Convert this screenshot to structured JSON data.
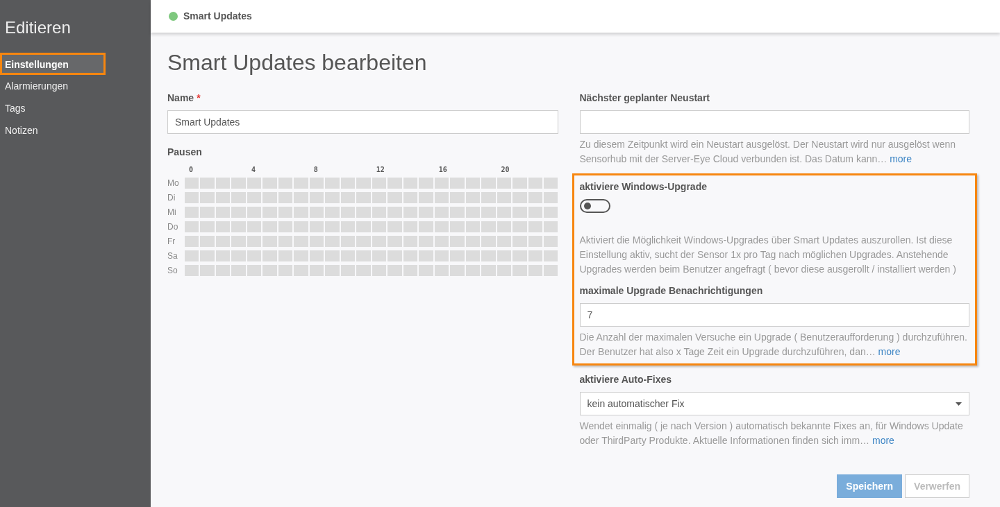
{
  "sidebar": {
    "title": "Editieren",
    "items": [
      {
        "label": "Einstellungen",
        "selected": true,
        "highlighted": true
      },
      {
        "label": "Alarmierungen",
        "selected": false,
        "highlighted": false
      },
      {
        "label": "Tags",
        "selected": false,
        "highlighted": false
      },
      {
        "label": "Notizen",
        "selected": false,
        "highlighted": false
      }
    ]
  },
  "header": {
    "title": "Smart Updates"
  },
  "page_title": "Smart Updates bearbeiten",
  "name_field": {
    "label": "Name",
    "required_mark": "*",
    "value": "Smart Updates"
  },
  "pauses": {
    "label": "Pausen",
    "hour_labels": [
      "0",
      "4",
      "8",
      "12",
      "16",
      "20"
    ],
    "rows": [
      {
        "label": "Mo",
        "paused": [
          false,
          false,
          false,
          false,
          false,
          false,
          false,
          false,
          false,
          false,
          false,
          false,
          false,
          false,
          false,
          false,
          false,
          false,
          false,
          false,
          false,
          false,
          false,
          false
        ]
      },
      {
        "label": "Di",
        "paused": [
          false,
          false,
          false,
          false,
          false,
          false,
          false,
          false,
          false,
          false,
          false,
          false,
          false,
          false,
          false,
          false,
          false,
          false,
          false,
          false,
          false,
          false,
          false,
          false
        ]
      },
      {
        "label": "Mi",
        "paused": [
          false,
          false,
          false,
          false,
          false,
          false,
          false,
          false,
          false,
          false,
          false,
          false,
          false,
          false,
          false,
          false,
          false,
          false,
          false,
          false,
          false,
          false,
          false,
          false
        ]
      },
      {
        "label": "Do",
        "paused": [
          false,
          false,
          false,
          false,
          false,
          false,
          false,
          false,
          false,
          false,
          false,
          false,
          false,
          false,
          false,
          false,
          false,
          false,
          false,
          false,
          false,
          false,
          false,
          false
        ]
      },
      {
        "label": "Fr",
        "paused": [
          false,
          false,
          false,
          false,
          false,
          false,
          false,
          false,
          false,
          false,
          false,
          false,
          false,
          false,
          false,
          false,
          false,
          false,
          false,
          false,
          false,
          false,
          false,
          false
        ]
      },
      {
        "label": "Sa",
        "paused": [
          false,
          false,
          false,
          false,
          false,
          false,
          false,
          false,
          false,
          false,
          false,
          false,
          false,
          false,
          false,
          false,
          false,
          false,
          false,
          false,
          false,
          false,
          false,
          false
        ]
      },
      {
        "label": "So",
        "paused": [
          false,
          false,
          false,
          false,
          false,
          false,
          false,
          false,
          false,
          false,
          false,
          false,
          false,
          false,
          false,
          false,
          false,
          false,
          false,
          false,
          false,
          false,
          false,
          false
        ]
      }
    ]
  },
  "right_fields": [
    {
      "kind": "text",
      "label": "Nächster geplanter Neustart",
      "help": "Zu diesem Zeitpunkt wird ein Neustart ausgelöst. Der Neustart wird nur ausgelöst wenn Sensorhub mit der Server-Eye Cloud verbunden ist. Das Datum kann…",
      "more": "more"
    },
    {
      "kind": "group",
      "highlighted": true,
      "children": [
        {
          "kind": "toggle",
          "label": "aktiviere Windows-Upgrade",
          "on": false,
          "help": "Aktiviert die Möglichkeit Windows-Upgrades über Smart Updates auszurollen. Ist diese Einstellung aktiv, sucht der Sensor 1x pro Tag nach möglichen Upgrades. Anstehende Upgrades werden beim Benutzer angefragt ( bevor diese ausgerollt / installiert werden )"
        },
        {
          "kind": "text",
          "label": "maximale Upgrade Benachrichtigungen",
          "value": "7",
          "help": "Die Anzahl der maximalen Versuche ein Upgrade ( Benutzeraufforderung ) durchzuführen. Der Benutzer hat also x Tage Zeit ein Upgrade durchzuführen, dan…",
          "more": "more"
        }
      ]
    },
    {
      "kind": "select",
      "label": "aktiviere Auto-Fixes",
      "value": "kein automatischer Fix",
      "help": "Wendet einmalig ( je nach Version ) automatisch bekannte Fixes an, für Windows Update oder ThirdParty Produkte. Aktuelle Informationen finden sich imm…",
      "more": "more"
    }
  ],
  "buttons": [
    {
      "label": "Speichern",
      "kind": "primary",
      "disabled": true
    },
    {
      "label": "Verwerfen",
      "kind": "secondary",
      "disabled": true
    }
  ]
}
